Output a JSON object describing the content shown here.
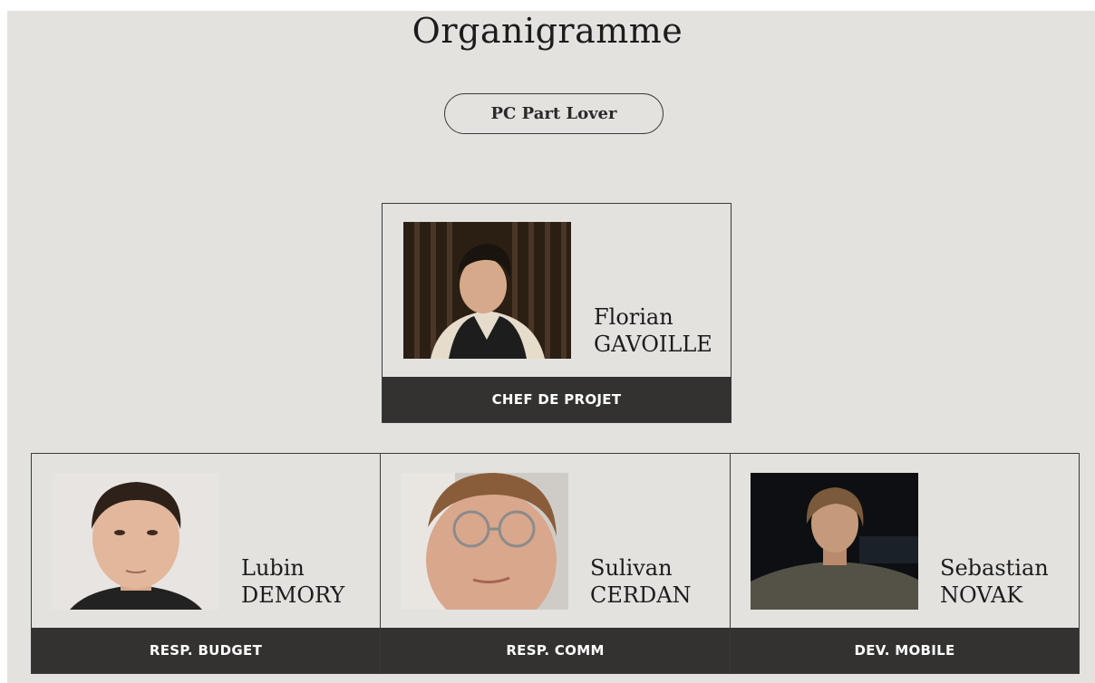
{
  "title": "Organigramme",
  "team": "PC Part Lover",
  "colors": {
    "background": "#e3e2df",
    "role_bar": "#333231",
    "text": "#1c1c1c"
  },
  "leader": {
    "first_name": "Florian",
    "last_name": "GAVOILLE",
    "role": "CHEF DE PROJET"
  },
  "members": [
    {
      "first_name": "Lubin",
      "last_name": "DEMORY",
      "role": "RESP. BUDGET"
    },
    {
      "first_name": "Sulivan",
      "last_name": "CERDAN",
      "role": "RESP. COMM"
    },
    {
      "first_name": "Sebastian",
      "last_name": "NOVAK",
      "role": "DEV. MOBILE"
    }
  ]
}
